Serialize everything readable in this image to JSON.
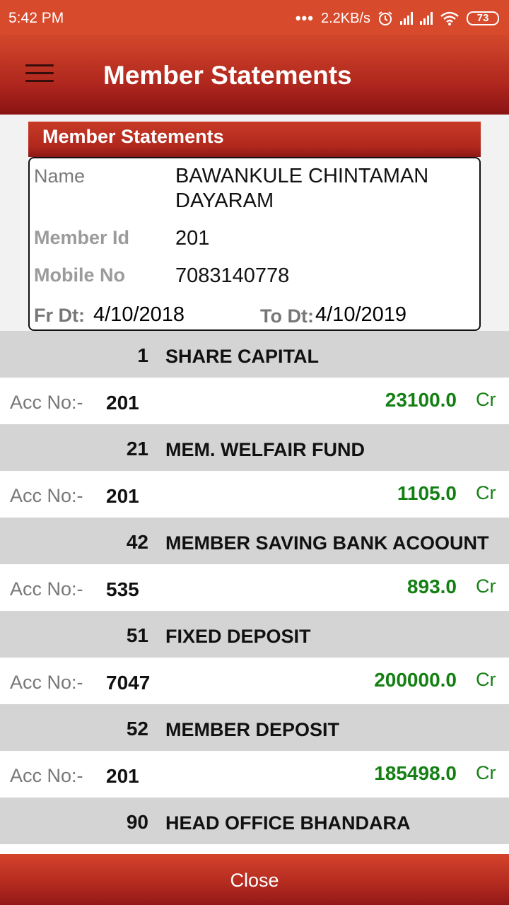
{
  "status_bar": {
    "time": "5:42 PM",
    "dots": "•••",
    "speed": "2.2KB/s",
    "alarm_icon": "alarm-icon",
    "signal_icon": "signal-icon",
    "wifi_icon": "wifi-icon",
    "battery": "73"
  },
  "app_bar": {
    "menu_icon": "hamburger-menu-icon",
    "title": "Member Statements"
  },
  "card": {
    "header": "Member Statements",
    "name_label": "Name",
    "name_value": "BAWANKULE  CHINTAMAN DAYARAM",
    "member_id_label": "Member Id",
    "member_id_value": "201",
    "mobile_label": "Mobile No",
    "mobile_value": "7083140778",
    "from_label": "Fr Dt:",
    "from_value": "4/10/2018",
    "to_label": "To Dt:",
    "to_value": "4/10/2019"
  },
  "accounts": [
    {
      "code": "1",
      "name": "SHARE CAPITAL",
      "acc_label": "Acc No:-",
      "acc_no": "201",
      "amount": "23100.0",
      "type": "Cr"
    },
    {
      "code": "21",
      "name": "MEM. WELFAIR FUND",
      "acc_label": "Acc No:-",
      "acc_no": "201",
      "amount": "1105.0",
      "type": "Cr"
    },
    {
      "code": "42",
      "name": "MEMBER SAVING BANK ACOOUNT",
      "acc_label": "Acc No:-",
      "acc_no": "535",
      "amount": "893.0",
      "type": "Cr"
    },
    {
      "code": "51",
      "name": "FIXED DEPOSIT",
      "acc_label": "Acc No:-",
      "acc_no": "7047",
      "amount": "200000.0",
      "type": "Cr"
    },
    {
      "code": "52",
      "name": "MEMBER DEPOSIT",
      "acc_label": "Acc No:-",
      "acc_no": "201",
      "amount": "185498.0",
      "type": "Cr"
    },
    {
      "code": "90",
      "name": "HEAD OFFICE BHANDARA"
    }
  ],
  "close_label": "Close",
  "colors": {
    "primary": "#b0271e",
    "status_bar": "#d84a2c",
    "amount_green": "#148014",
    "group_row_bg": "#d4d4d4"
  }
}
